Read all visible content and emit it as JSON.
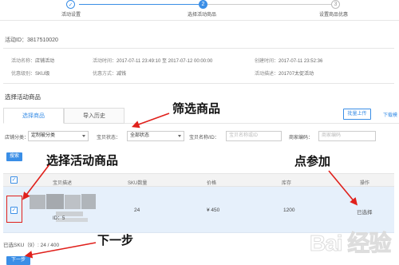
{
  "steps": [
    {
      "num": "✓",
      "label": "活动设置"
    },
    {
      "num": "2",
      "label": "选择活动商品"
    },
    {
      "num": "3",
      "label": "设置商品优惠"
    }
  ],
  "activity": {
    "id_label": "活动ID：3817510020",
    "name_label": "活动名称：",
    "name_value": "店铺活动",
    "time_label": "活动时间：",
    "time_value": "2017-07-11 23:49:10 至 2017-07-12 00:00:00",
    "created_label": "创建时间：",
    "created_value": "2017-07-11 23:52:36",
    "level_label": "优惠级别：",
    "level_value": "SKU级",
    "method_label": "优惠方式：",
    "method_value": "减钱",
    "desc_label": "活动描述：",
    "desc_value": "201707太促活动"
  },
  "section_title": "选择活动商品",
  "tabs": {
    "select": "选择商品",
    "import": "导入历史"
  },
  "toolbar": {
    "bulk_upload": "批量上传",
    "download_template": "下载模"
  },
  "filters": {
    "category_label": "店铺分类：",
    "category_value": "定制被分类",
    "status_label": "宝贝状态：",
    "status_value": "全部状态",
    "name_label": "宝贝名称/ID：",
    "name_placeholder": "宝贝名称或ID",
    "code_label": "商家编码：",
    "code_placeholder": "商家编码",
    "search_button": "搜索"
  },
  "table": {
    "headers": {
      "desc": "宝贝描述",
      "sku": "SKU数量",
      "price": "价格",
      "stock": "库存",
      "op": "操作"
    },
    "rows": [
      {
        "id": "ID：5",
        "sku": "24",
        "price": "¥ 450",
        "stock": "1200",
        "status": "已选择"
      }
    ]
  },
  "selected_summary": "已选SKU（9）: 24 / 400",
  "next_button": "下一步",
  "annotations": {
    "filter": "筛选商品",
    "select": "选择活动商品",
    "join": "点参加",
    "next": "下一步"
  },
  "watermark": "Bai 经验",
  "colors": {
    "accent": "#3a8ee6",
    "annotation_red": "#e0201b"
  }
}
